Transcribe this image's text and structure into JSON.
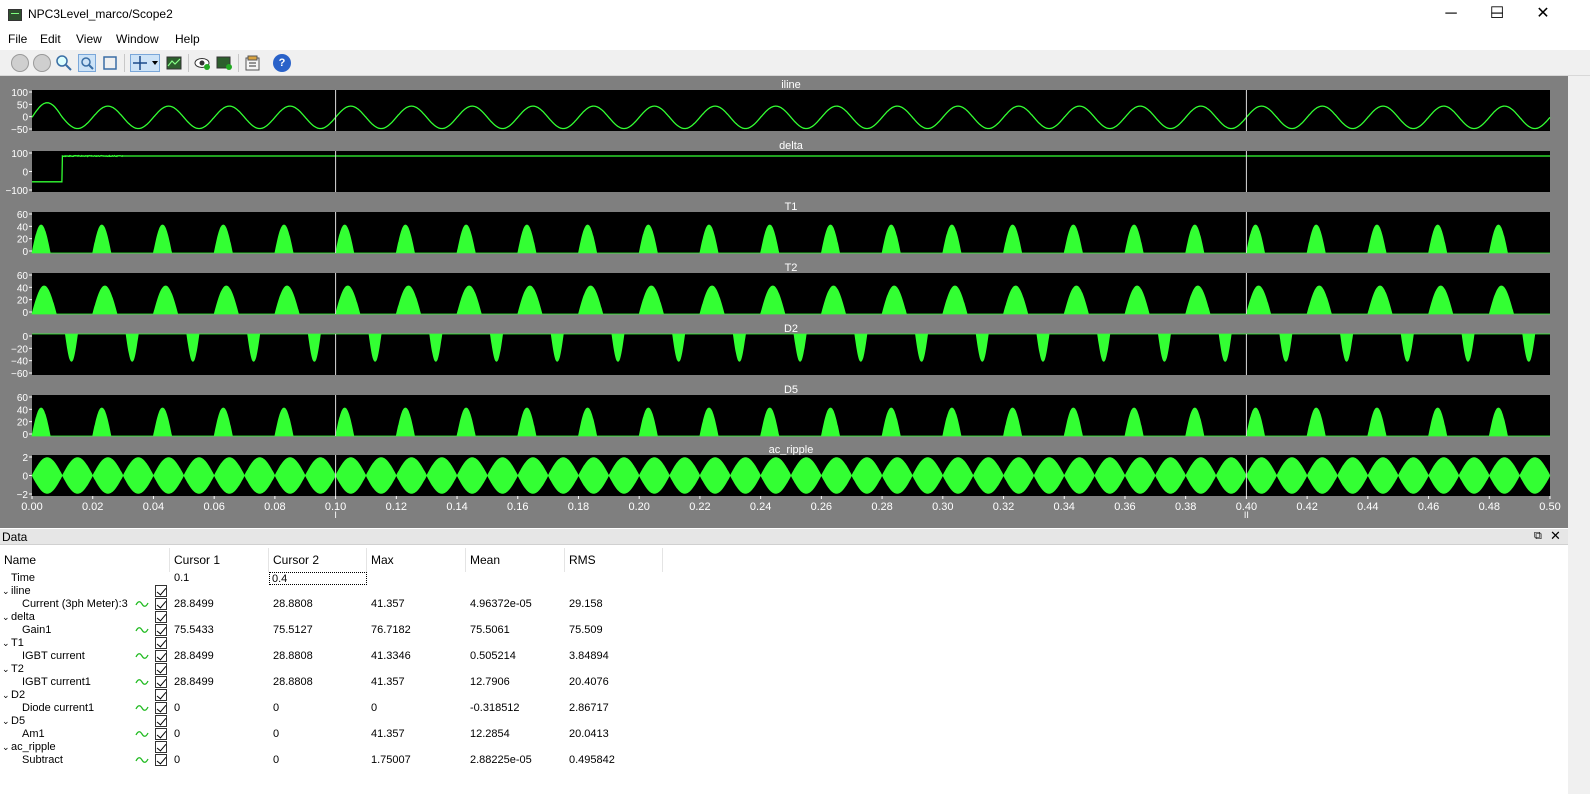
{
  "window": {
    "title": "NPC3Level_marco/Scope2",
    "minimize": "─",
    "maximize": "☐",
    "close": "✕"
  },
  "menu": [
    "File",
    "Edit",
    "View",
    "Window",
    "Help"
  ],
  "toolbar_icons": [
    "back-icon",
    "forward-icon",
    "zoom-icon",
    "zoom-x-icon",
    "zoom-fit-icon",
    "cursor-measure-icon",
    "style-icon",
    "highlight-icon",
    "signal-selector-icon",
    "properties-icon",
    "help-icon"
  ],
  "colors": {
    "trace": "#33ff33",
    "plot_bg": "#000000",
    "frame": "#7f7f7f",
    "cursor": "#dcdcdc"
  },
  "plots": [
    {
      "title": "iline",
      "yticks": [
        "100",
        "50",
        "0",
        "−50"
      ]
    },
    {
      "title": "delta",
      "yticks": [
        "100",
        "0",
        "−100"
      ]
    },
    {
      "title": "T1",
      "yticks": [
        "60",
        "40",
        "20",
        "0"
      ]
    },
    {
      "title": "T2",
      "yticks": [
        "60",
        "40",
        "20",
        "0"
      ]
    },
    {
      "title": "D2",
      "yticks": [
        "0",
        "−20",
        "−40",
        "−60"
      ]
    },
    {
      "title": "D5",
      "yticks": [
        "60",
        "40",
        "20",
        "0"
      ]
    },
    {
      "title": "ac_ripple",
      "yticks": [
        "2",
        "0",
        "−2"
      ]
    }
  ],
  "xaxis": {
    "ticks": [
      "0.00",
      "0.02",
      "0.04",
      "0.06",
      "0.08",
      "0.10",
      "0.12",
      "0.14",
      "0.16",
      "0.18",
      "0.20",
      "0.22",
      "0.24",
      "0.26",
      "0.28",
      "0.30",
      "0.32",
      "0.34",
      "0.36",
      "0.38",
      "0.40",
      "0.42",
      "0.44",
      "0.46",
      "0.48",
      "0.50"
    ],
    "range": [
      0,
      0.5
    ]
  },
  "cursors": [
    {
      "label": "I",
      "time": 0.1
    },
    {
      "label": "II",
      "time": 0.4
    }
  ],
  "chart_data": [
    {
      "type": "line",
      "title": "iline",
      "ylim": [
        -50,
        100
      ],
      "x_range": [
        0,
        0.5
      ],
      "series": [
        {
          "name": "Current (3ph Meter):3",
          "shape": "sine",
          "frequency_hz": 50,
          "amplitude": 41,
          "mean": 0
        }
      ]
    },
    {
      "type": "line",
      "title": "delta",
      "ylim": [
        -100,
        100
      ],
      "x_range": [
        0,
        0.5
      ],
      "series": [
        {
          "name": "Gain1",
          "shape": "step",
          "initial": -50,
          "settled": 75.5,
          "step_time": 0.01
        }
      ]
    },
    {
      "type": "area",
      "title": "T1",
      "ylim": [
        0,
        60
      ],
      "x_range": [
        0,
        0.5
      ],
      "series": [
        {
          "name": "IGBT current",
          "shape": "half-sine-pulses",
          "frequency_hz": 50,
          "peak": 41
        }
      ]
    },
    {
      "type": "area",
      "title": "T2",
      "ylim": [
        0,
        60
      ],
      "x_range": [
        0,
        0.5
      ],
      "series": [
        {
          "name": "IGBT current1",
          "shape": "pulses",
          "frequency_hz": 50,
          "peak": 41
        }
      ]
    },
    {
      "type": "area",
      "title": "D2",
      "ylim": [
        -60,
        0
      ],
      "x_range": [
        0,
        0.5
      ],
      "series": [
        {
          "name": "Diode current1",
          "shape": "negative-pulses",
          "frequency_hz": 50,
          "peak": -40
        }
      ]
    },
    {
      "type": "area",
      "title": "D5",
      "ylim": [
        0,
        60
      ],
      "x_range": [
        0,
        0.5
      ],
      "series": [
        {
          "name": "Am1",
          "shape": "half-sine-pulses",
          "frequency_hz": 50,
          "peak": 41
        }
      ]
    },
    {
      "type": "area",
      "title": "ac_ripple",
      "ylim": [
        -2,
        2
      ],
      "x_range": [
        0,
        0.5
      ],
      "series": [
        {
          "name": "Subtract",
          "shape": "modulated-envelope",
          "frequency_hz": 100,
          "peak": 1.75
        }
      ]
    }
  ],
  "data_panel": {
    "title": "Data",
    "float_icon": "⧉",
    "close_icon": "✕",
    "columns": [
      "Name",
      "Cursor 1",
      "Cursor 2",
      "Max",
      "Mean",
      "RMS"
    ],
    "time_row": {
      "label": "Time",
      "cursor1": "0.1",
      "cursor2": "0.4"
    },
    "groups": [
      {
        "group": "iline",
        "signal": "Current (3ph Meter):3",
        "c1": "28.8499",
        "c2": "28.8808",
        "max": "41.357",
        "mean": "4.96372e-05",
        "rms": "29.158"
      },
      {
        "group": "delta",
        "signal": "Gain1",
        "c1": "75.5433",
        "c2": "75.5127",
        "max": "76.7182",
        "mean": "75.5061",
        "rms": "75.509"
      },
      {
        "group": "T1",
        "signal": "IGBT current",
        "c1": "28.8499",
        "c2": "28.8808",
        "max": "41.3346",
        "mean": "0.505214",
        "rms": "3.84894"
      },
      {
        "group": "T2",
        "signal": "IGBT current1",
        "c1": "28.8499",
        "c2": "28.8808",
        "max": "41.357",
        "mean": "12.7906",
        "rms": "20.4076"
      },
      {
        "group": "D2",
        "signal": "Diode current1",
        "c1": "0",
        "c2": "0",
        "max": "0",
        "mean": "-0.318512",
        "rms": "2.86717"
      },
      {
        "group": "D5",
        "signal": "Am1",
        "c1": "0",
        "c2": "0",
        "max": "41.357",
        "mean": "12.2854",
        "rms": "20.0413"
      },
      {
        "group": "ac_ripple",
        "signal": "Subtract",
        "c1": "0",
        "c2": "0",
        "max": "1.75007",
        "mean": "2.88225e-05",
        "rms": "0.495842"
      }
    ]
  }
}
